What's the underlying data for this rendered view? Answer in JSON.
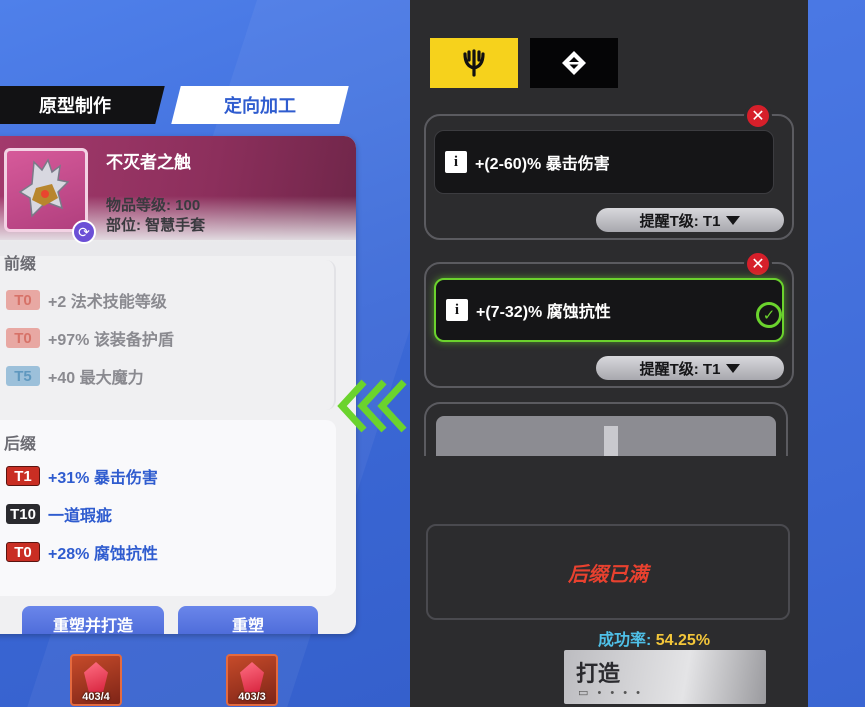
{
  "tabs": {
    "prototype": "原型制作",
    "directional": "定向加工"
  },
  "item": {
    "name": "不灭者之触",
    "level_text": "物品等级: 100",
    "slot_text": "部位: 智慧手套"
  },
  "prefix": {
    "label": "前缀",
    "affixes": [
      {
        "tier": "T0",
        "text": "+2 法术技能等级"
      },
      {
        "tier": "T0",
        "text": "+97% 该装备护盾"
      },
      {
        "tier": "T5",
        "text": "+40 最大魔力"
      }
    ]
  },
  "suffix": {
    "label": "后缀",
    "affixes": [
      {
        "tier": "T1",
        "text": "+31% 暴击伤害"
      },
      {
        "tier": "T10",
        "text": "一道瑕疵"
      },
      {
        "tier": "T0",
        "text": "+28% 腐蚀抗性"
      }
    ]
  },
  "buttons": {
    "reshape_and_forge": "重塑并打造",
    "reshape": "重塑",
    "forge": "打造"
  },
  "materials": [
    {
      "count": "403/4"
    },
    {
      "count": "403/3"
    }
  ],
  "slots": [
    {
      "text": "+(2-60)% 暴击伤害",
      "tier_select": "提醒T级: T1"
    },
    {
      "text": "+(7-32)% 腐蚀抗性",
      "tier_select": "提醒T级: T1"
    }
  ],
  "status": {
    "full_text": "后缀已满",
    "rate_label": "成功率: ",
    "rate_value": "54.25%"
  },
  "icons": {
    "type_1": "trident-icon",
    "type_2": "diamond-icon"
  },
  "colors": {
    "accent_yellow": "#f6d21c",
    "accent_green": "#6bd32d",
    "accent_blue": "#2f5ccf",
    "warning_red": "#e8412f"
  }
}
